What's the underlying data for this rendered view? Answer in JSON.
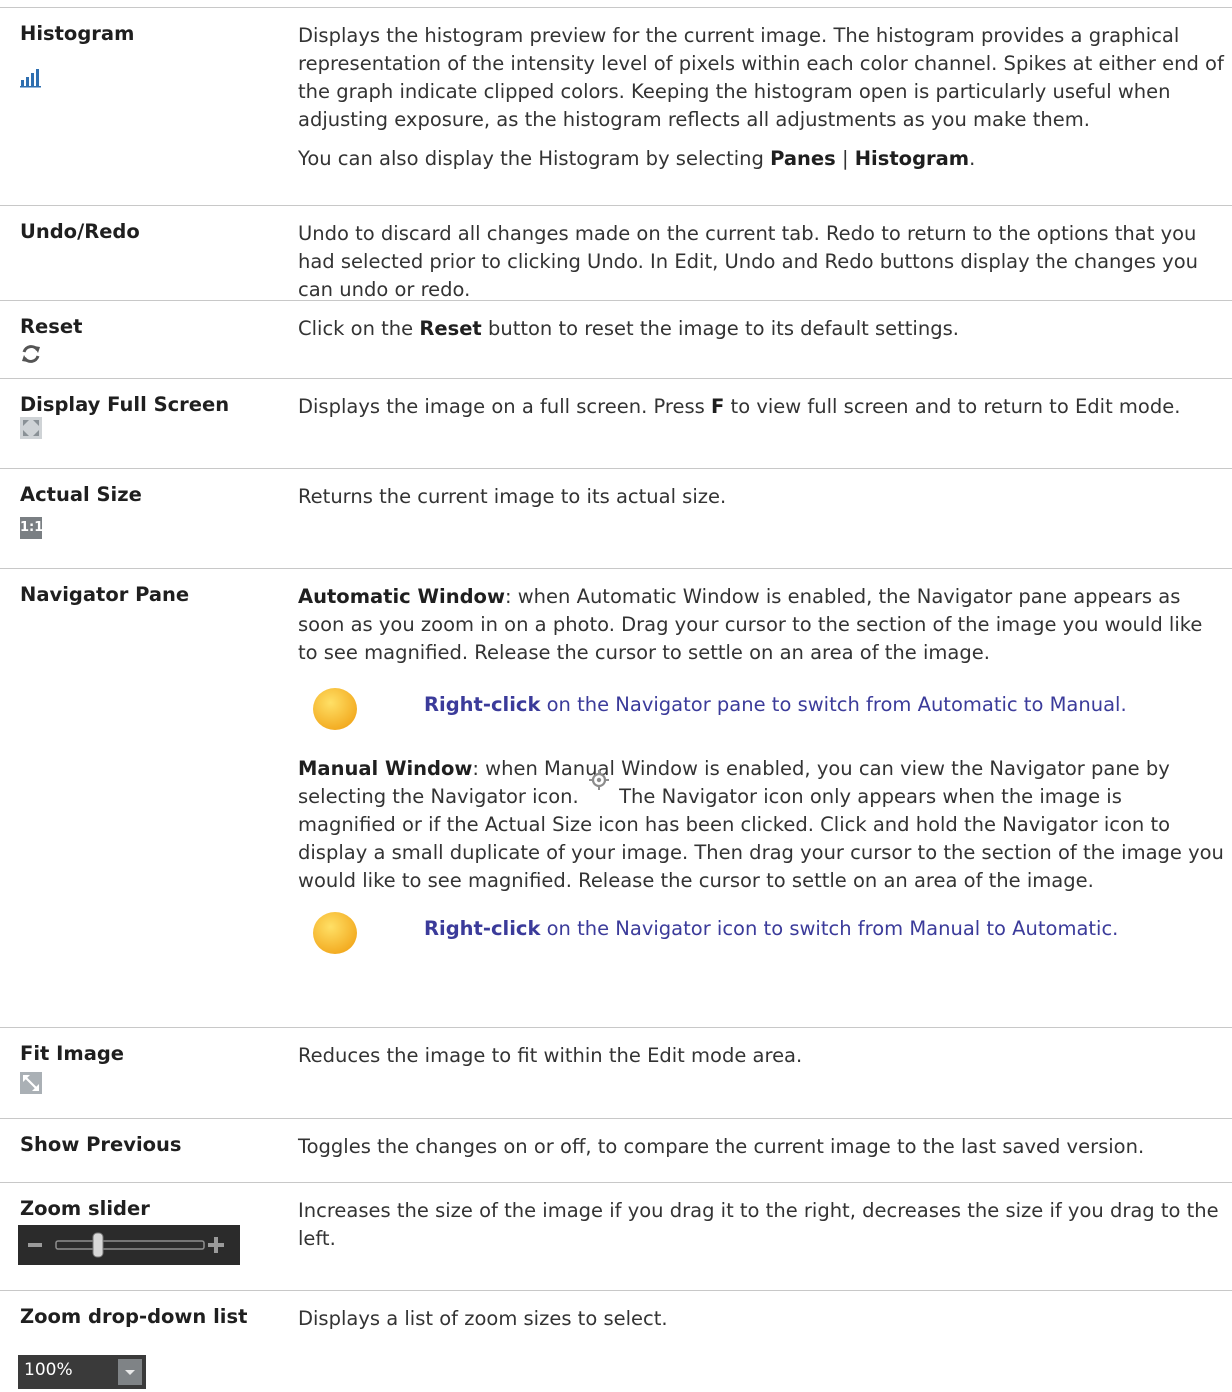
{
  "rows": [
    {
      "term": "Histogram",
      "icon": "histogram-icon",
      "desc": "Displays the histogram preview for the current image. The histogram provides a graphical representation of the intensity level of pixels within each color channel. Spikes at either end of the graph indicate clipped colors. Keeping the histogram open is particularly useful when adjusting exposure, as the histogram reflects all adjustments as you make them.",
      "desc2_pre": "You can also display the Histogram by selecting ",
      "desc2_b1": "Panes",
      "desc2_sep": " | ",
      "desc2_b2": "Histogram",
      "desc2_post": "."
    },
    {
      "term": "Undo/Redo",
      "desc": "Undo to discard all changes made on the current tab. Redo to return to the options that you had selected prior to clicking Undo. In Edit, Undo and Redo buttons display the changes you can undo or redo."
    },
    {
      "term": "Reset",
      "icon": "reset-icon",
      "desc_pre": "Click on the ",
      "desc_b": "Reset",
      "desc_post": " button to reset the image to its default settings."
    },
    {
      "term": "Display Full Screen",
      "icon": "fullscreen-icon",
      "desc_pre": "Displays the image on a full screen. Press ",
      "desc_b": "F",
      "desc_post": " to view full screen and to return to Edit mode."
    },
    {
      "term": "Actual Size",
      "icon": "actual-size-icon",
      "icon_text": "1:1",
      "desc": "Returns the current image to its actual size."
    },
    {
      "term": "Navigator Pane",
      "auto_b": "Automatic Window",
      "auto_text": ": when Automatic Window is enabled, the Navigator pane appears as soon as you zoom in on a photo. Drag your cursor to the section of the image you would like to see magnified. Release the cursor to settle on an area of the image.",
      "tip1_b": "Right-click",
      "tip1_text": " on the Navigator pane to switch from Automatic to Manual.",
      "manual_b": "Manual Window",
      "manual_text1": ": when Manual Window is enabled, you can view the Navigator pane by selecting the Navigator icon.",
      "manual_icon": "navigator-icon",
      "manual_text2": " The Navigator icon only appears when the image is magnified or if the Actual Size icon has been clicked. Click and hold the Navigator icon to display a small duplicate of your image. Then drag your cursor to the section of the image you would like to see magnified. Release the cursor to settle on an area of the image.",
      "tip2_b": "Right-click",
      "tip2_text": " on the Navigator icon to switch from Manual to Automatic."
    },
    {
      "term": "Fit Image",
      "icon": "fit-image-icon",
      "desc": "Reduces the image to fit within the Edit mode area."
    },
    {
      "term": "Show Previous",
      "desc": "Toggles the changes on or off, to compare the current image to the last saved version."
    },
    {
      "term": "Zoom slider",
      "icon": "zoom-slider-control",
      "desc": "Increases the size of the image if you drag it to the right, decreases the size if you drag to the left."
    },
    {
      "term": "Zoom drop-down list",
      "icon": "zoom-dropdown-control",
      "zoom_value": "100%",
      "desc": "Displays a list of zoom sizes to select."
    }
  ],
  "colors": {
    "border": "#c8c8c8",
    "tip_text": "#3b3b9a",
    "icon_blue": "#2f6fb0",
    "slider_bg": "#2b2b2b"
  }
}
